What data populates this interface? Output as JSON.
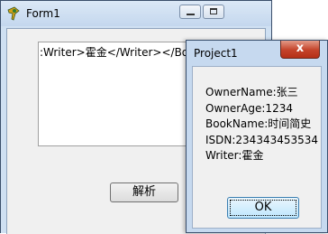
{
  "form1": {
    "title": "Form1",
    "textbox_value": ":Writer>霍金</Writer></BookMessage>",
    "parse_button_label": "解析"
  },
  "project1": {
    "title": "Project1",
    "close_glyph": "x",
    "lines": [
      "OwnerName:张三",
      "OwnerAge:1234",
      "BookName:时间简史",
      "ISDN:234343453534",
      "Writer:霍金"
    ],
    "ok_label": "OK"
  },
  "icons": {
    "app": "delphi-app-icon",
    "minimize": "minimize-icon",
    "maximize": "maximize-icon",
    "close": "close-icon"
  }
}
